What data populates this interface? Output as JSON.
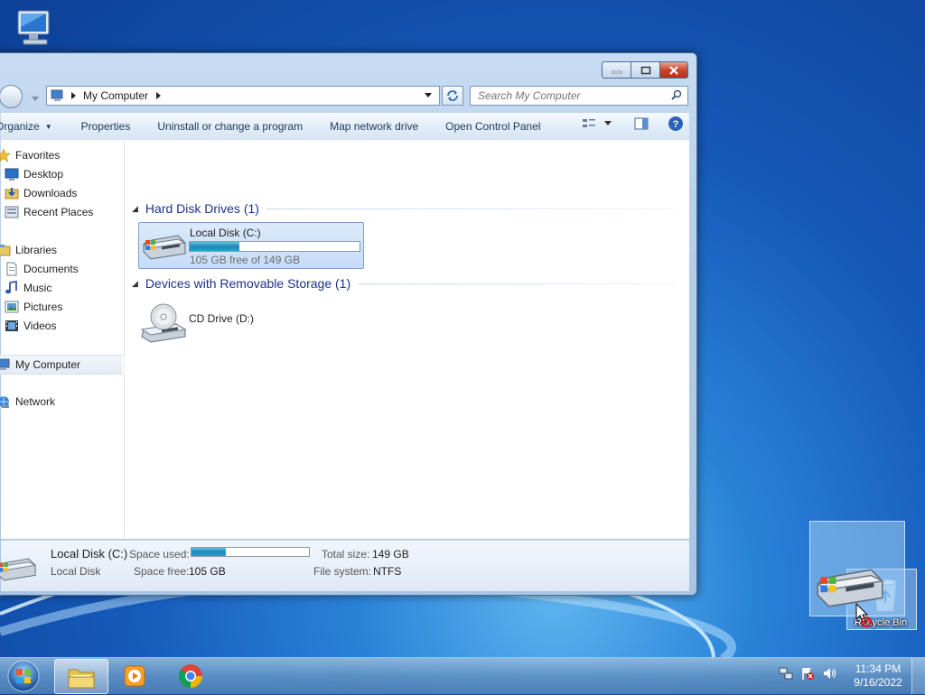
{
  "explorer": {
    "address": {
      "crumb": "My Computer"
    },
    "search": {
      "placeholder": "Search My Computer"
    },
    "toolbar": {
      "organize": "Organize",
      "properties": "Properties",
      "uninstall": "Uninstall or change a program",
      "map_network": "Map network drive",
      "control_panel": "Open Control Panel"
    },
    "nav": {
      "favorites": "Favorites",
      "desktop": "Desktop",
      "downloads": "Downloads",
      "recent_places": "Recent Places",
      "libraries": "Libraries",
      "documents": "Documents",
      "music": "Music",
      "pictures": "Pictures",
      "videos": "Videos",
      "my_computer": "My Computer",
      "network": "Network"
    },
    "groups": {
      "hard_disks": "Hard Disk Drives (1)",
      "removable": "Devices with Removable Storage (1)"
    },
    "drive_c": {
      "name": "Local Disk (C:)",
      "free_text": "105 GB free of 149 GB",
      "used_fraction": 0.295
    },
    "drive_d": {
      "name": "CD Drive (D:)"
    },
    "details": {
      "name": "Local Disk (C:)",
      "type": "Local Disk",
      "space_used_label": "Space used:",
      "space_free_label": "Space free:",
      "space_free_value": "105 GB",
      "total_size_label": "Total size:",
      "total_size_value": "149 GB",
      "file_system_label": "File system:",
      "file_system_value": "NTFS"
    }
  },
  "desktop": {
    "recycle_bin": "Recycle Bin"
  },
  "taskbar": {
    "time": "11:34 PM",
    "date": "9/16/2022"
  },
  "colors": {
    "accent": "#1e3287",
    "bar_fill": "#1a8ab8",
    "close": "#c9462c"
  }
}
